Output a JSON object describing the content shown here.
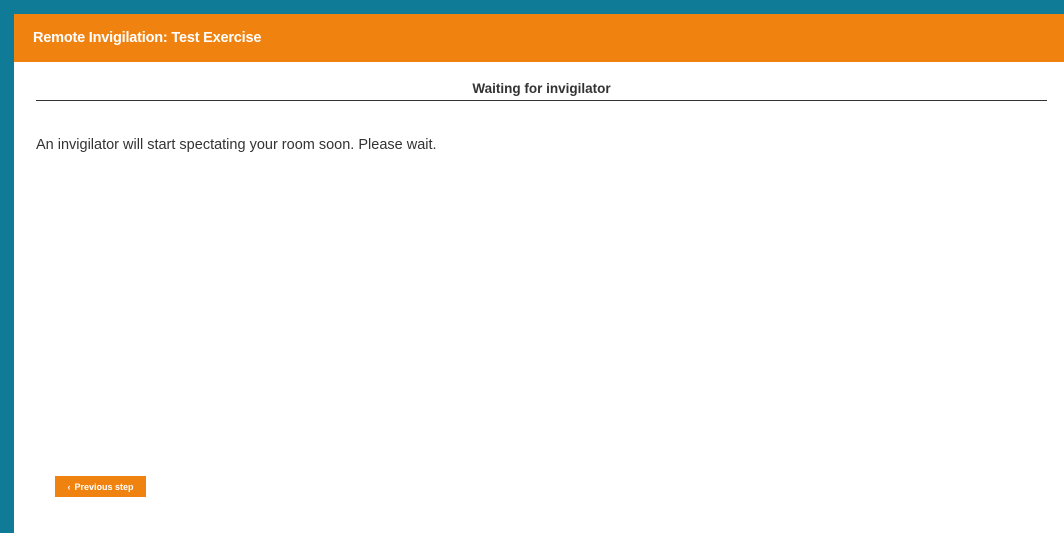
{
  "header": {
    "title": "Remote Invigilation: Test Exercise"
  },
  "step": {
    "title": "Waiting for invigilator",
    "message": "An invigilator will start spectating your room soon. Please wait."
  },
  "navigation": {
    "previous_label": "Previous step",
    "previous_icon": "chevron-left-icon"
  },
  "colors": {
    "accent": "#f0820f",
    "frame": "#0f7b96",
    "text": "#333333"
  }
}
